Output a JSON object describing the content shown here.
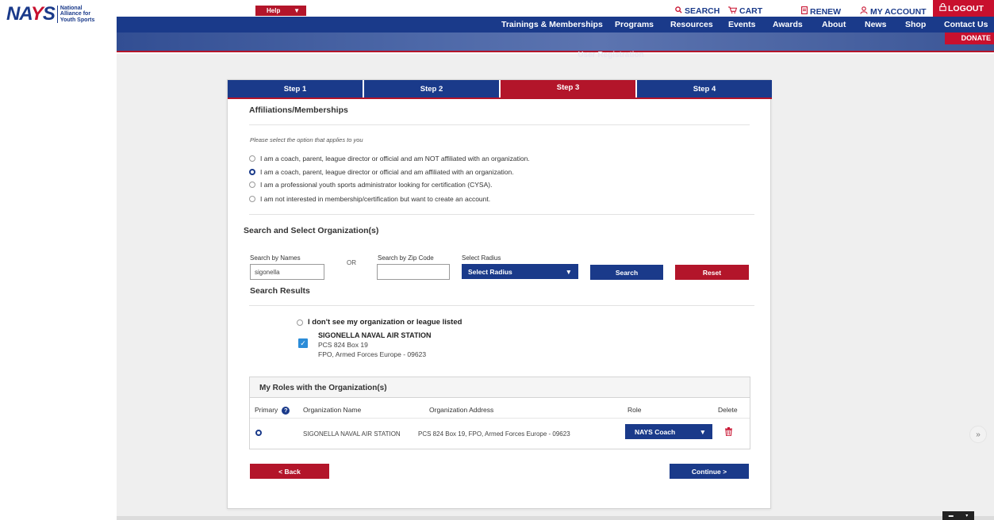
{
  "logo": {
    "mark_n": "NA",
    "mark_a": "Y",
    "mark_s": "S",
    "text": "National Alliance for Youth Sports"
  },
  "header": {
    "help_label": "Help",
    "util": {
      "search": "SEARCH",
      "cart": "CART",
      "renew": "RENEW",
      "account": "MY ACCOUNT",
      "logout": "LOGOUT"
    },
    "nav": [
      "Trainings & Memberships",
      "Programs",
      "Resources",
      "Events",
      "Awards",
      "About",
      "News",
      "Shop",
      "Contact Us"
    ],
    "donate": "DONATE",
    "page_heading": "User Registration"
  },
  "steps": [
    "Step 1",
    "Step 2",
    "Step 3",
    "Step 4"
  ],
  "affiliations": {
    "title": "Affiliations/Memberships",
    "hint": "Please select the option that applies to you",
    "options": [
      "I am a coach, parent, league director or official and am NOT affiliated with an organization.",
      "I am a coach, parent, league director or official and am affiliated with an organization.",
      "I am a professional youth sports administrator looking for certification (CYSA).",
      "I am not interested in membership/certification but want to create an account."
    ],
    "selected_index": 1
  },
  "search": {
    "title": "Search and Select Organization(s)",
    "name_label": "Search by Names",
    "name_value": "sigonella",
    "or_label": "OR",
    "zip_label": "Search by Zip Code",
    "zip_value": "",
    "radius_label": "Select Radius",
    "radius_value": "Select Radius",
    "search_button": "Search",
    "reset_button": "Reset"
  },
  "results": {
    "title": "Search Results",
    "none_option": "I don't see my organization or league listed",
    "org_name": "SIGONELLA NAVAL AIR STATION",
    "org_address1": "PCS 824 Box 19",
    "org_address2": "FPO, Armed Forces Europe - 09623"
  },
  "roles": {
    "title": "My Roles with the Organization(s)",
    "headers": {
      "primary": "Primary",
      "org_name": "Organization Name",
      "org_address": "Organization Address",
      "role": "Role",
      "delete": "Delete"
    },
    "row": {
      "org_name": "SIGONELLA NAVAL AIR STATION",
      "org_address": "PCS 824 Box 19, FPO, Armed Forces Europe - 09623",
      "role": "NAYS Coach"
    }
  },
  "nav_buttons": {
    "back": "< Back",
    "continue": "Continue >"
  },
  "colors": {
    "navy": "#1a3a8a",
    "red": "#b3152a",
    "checkbox_blue": "#2b8cd8"
  }
}
